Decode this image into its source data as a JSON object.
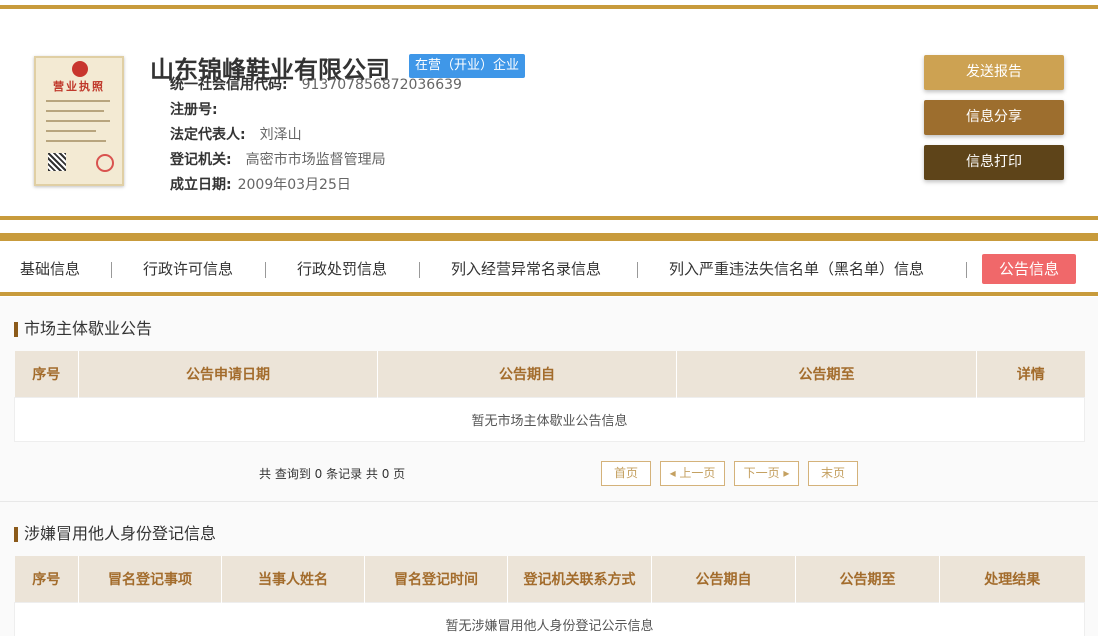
{
  "header": {
    "license_title": "营业执照",
    "company_name": "山东锦峰鞋业有限公司",
    "status": "在营（开业）企业",
    "fields": [
      {
        "label": "统一社会信用代码:",
        "value": "913707856872036639"
      },
      {
        "label": "注册号:",
        "value": ""
      },
      {
        "label": "法定代表人:",
        "value": "刘泽山"
      },
      {
        "label": "登记机关:",
        "value": "高密市市场监督管理局"
      },
      {
        "label": "成立日期:",
        "value": "2009年03月25日"
      }
    ],
    "buttons": {
      "report": "发送报告",
      "share": "信息分享",
      "print": "信息打印"
    }
  },
  "tabs": [
    {
      "label": "基础信息"
    },
    {
      "label": "行政许可信息"
    },
    {
      "label": "行政处罚信息"
    },
    {
      "label": "列入经营异常名录信息"
    },
    {
      "label": "列入严重违法失信名单（黑名单）信息"
    },
    {
      "label": "公告信息",
      "active": true
    }
  ],
  "section1": {
    "title": "市场主体歇业公告",
    "columns": [
      "序号",
      "公告申请日期",
      "公告期自",
      "公告期至",
      "详情"
    ],
    "empty": "暂无市场主体歇业公告信息",
    "pager": {
      "summary": "共 查询到 0 条记录 共 0 页",
      "first": "首页",
      "prev": "◂ 上一页",
      "next": "下一页 ▸",
      "last": "末页"
    }
  },
  "section2": {
    "title": "涉嫌冒用他人身份登记信息",
    "columns": [
      "序号",
      "冒名登记事项",
      "当事人姓名",
      "冒名登记时间",
      "登记机关联系方式",
      "公告期自",
      "公告期至",
      "处理结果"
    ],
    "empty": "暂无涉嫌冒用他人身份登记公示信息"
  },
  "colors": {
    "gold": "#c89b3c",
    "badge_blue": "#3f97e8",
    "active_tab": "#f0686a",
    "table_header_bg": "#ece4d8",
    "table_header_text": "#a36c2c"
  }
}
